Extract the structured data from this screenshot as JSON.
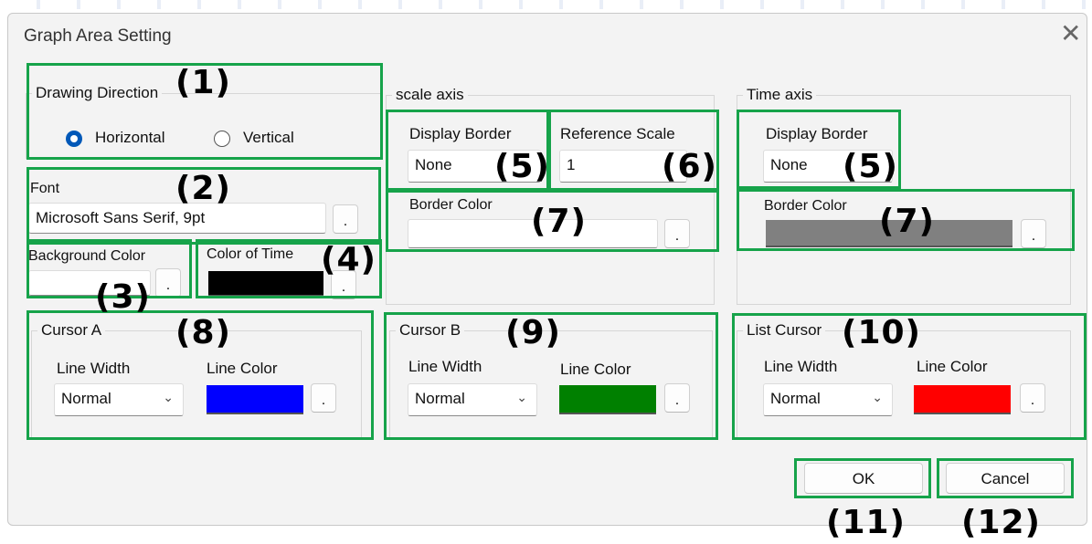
{
  "window": {
    "title": "Graph Area Setting",
    "close_glyph": "✕"
  },
  "drawing_direction": {
    "legend": "Drawing Direction",
    "option_horizontal": "Horizontal",
    "option_vertical": "Vertical",
    "selected": "Horizontal"
  },
  "font": {
    "label": "Font",
    "value": "Microsoft Sans Serif, 9pt"
  },
  "background_color": {
    "label": "Background Color",
    "color": "#ffffff"
  },
  "color_of_time": {
    "label": "Color of Time",
    "color": "#000000"
  },
  "scale_axis": {
    "legend": "scale axis",
    "display_border_label": "Display Border",
    "display_border_value": "None",
    "reference_scale_label": "Reference Scale",
    "reference_scale_value": "1",
    "border_color_label": "Border Color",
    "border_color": "#ffffff"
  },
  "time_axis": {
    "legend": "Time axis",
    "display_border_label": "Display Border",
    "display_border_value": "None",
    "border_color_label": "Border Color",
    "border_color": "#808080"
  },
  "cursor_a": {
    "legend": "Cursor A",
    "line_width_label": "Line Width",
    "line_width": "Normal",
    "line_color_label": "Line Color",
    "color": "#0000ff"
  },
  "cursor_b": {
    "legend": "Cursor B",
    "line_width_label": "Line Width",
    "line_width": "Normal",
    "line_color_label": "Line Color",
    "color": "#008000"
  },
  "list_cursor": {
    "legend": "List Cursor",
    "line_width_label": "Line Width",
    "line_width": "Normal",
    "line_color_label": "Line Color",
    "color": "#ff0000"
  },
  "browse_glyph": ".",
  "buttons": {
    "ok": "OK",
    "cancel": "Cancel"
  },
  "annotations": {
    "a1": "(1)",
    "a2": "(2)",
    "a3": "(3)",
    "a4": "(4)",
    "a5": "(5)",
    "a6": "(6)",
    "a7": "(7)",
    "a8": "(8)",
    "a9": "(9)",
    "a10": "(10)",
    "a11": "(11)",
    "a12": "(12)"
  },
  "colors": {
    "highlight": "#16a34a",
    "accent": "#0058b8"
  }
}
